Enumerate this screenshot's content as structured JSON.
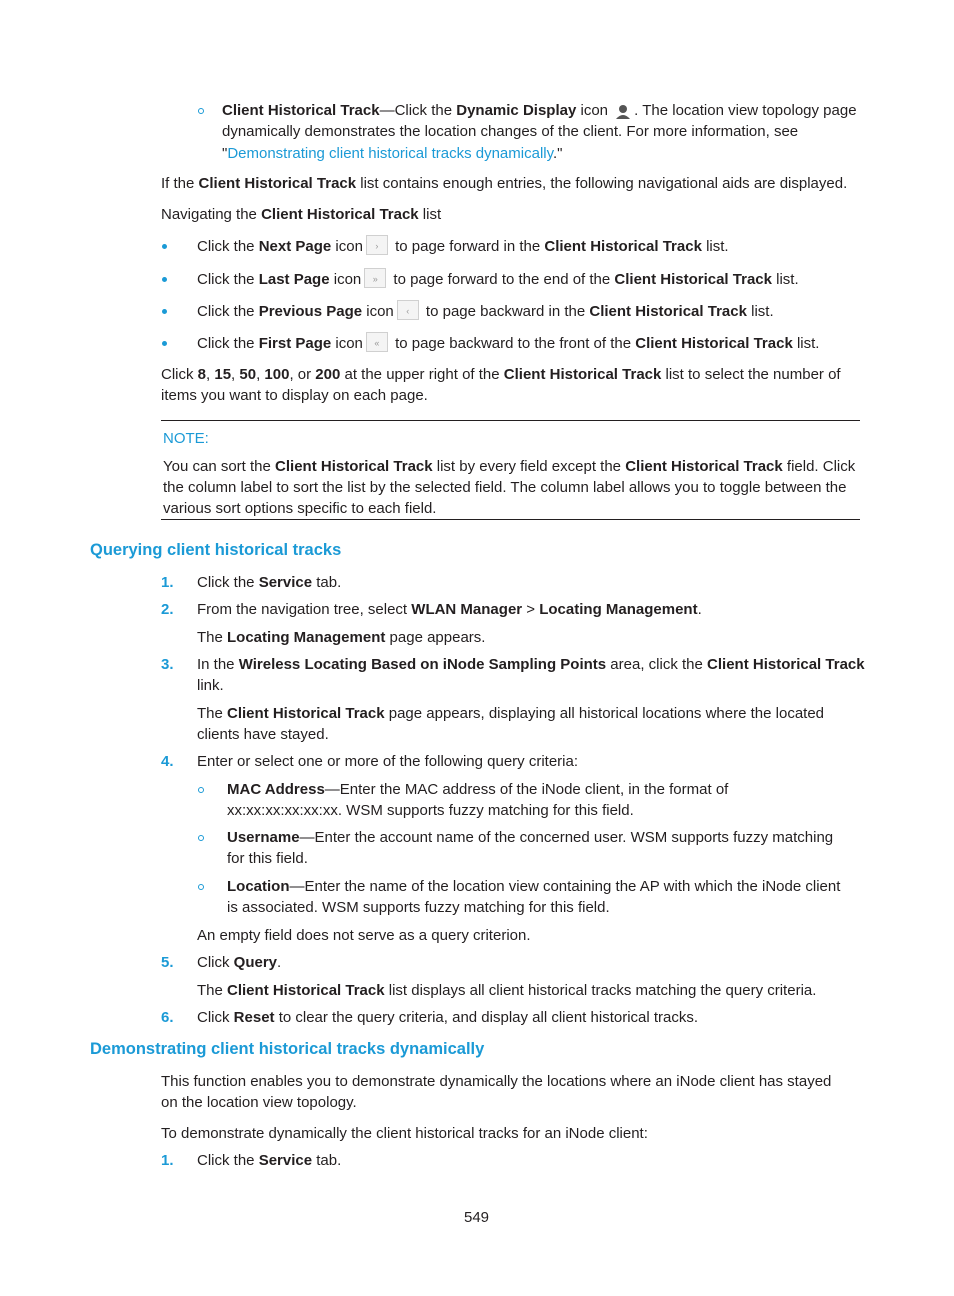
{
  "top_item": {
    "label": "Client Historical Track",
    "dash_text": "—Click the ",
    "dynamic_display": "Dynamic Display",
    "icon_text": " icon ",
    "icon": "person-icon",
    "after_icon": ". The location view topology page",
    "line2": "dynamically demonstrates the location changes of the client. For more information, see",
    "quote_open": "\"",
    "link_text": "Demonstrating client historical tracks dynamically",
    "quote_close": ".\""
  },
  "para_enough": {
    "pre": "If the ",
    "bold": "Client Historical Track",
    "post": " list contains enough entries, the following navigational aids are displayed."
  },
  "nav_label": {
    "pre": "Navigating the ",
    "bold": "Client Historical Track",
    "post": " list"
  },
  "nav_items": [
    {
      "pre": "Click the ",
      "bold": "Next Page",
      "mid": " icon",
      "icon": "›",
      "icon_name": "next-page-icon",
      "post": " to page forward in the ",
      "bold2": "Client Historical Track",
      "end": " list."
    },
    {
      "pre": "Click the ",
      "bold": "Last Page",
      "mid": " icon",
      "icon": "»",
      "icon_name": "last-page-icon",
      "post": " to page forward to the end of the ",
      "bold2": "Client Historical Track",
      "end": " list."
    },
    {
      "pre": "Click the ",
      "bold": "Previous Page",
      "mid": " icon",
      "icon": "‹",
      "icon_name": "previous-page-icon",
      "post": " to page backward in the ",
      "bold2": "Client Historical Track",
      "end": " list."
    },
    {
      "pre": "Click the ",
      "bold": "First Page",
      "mid": " icon",
      "icon": "«",
      "icon_name": "first-page-icon",
      "post": " to page backward to the front of the ",
      "bold2": "Client Historical Track",
      "end": " list."
    }
  ],
  "page_size": {
    "pre": "Click ",
    "n1": "8",
    "c1": ", ",
    "n2": "15",
    "c2": ", ",
    "n3": "50",
    "c3": ", ",
    "n4": "100",
    "c4": ", or ",
    "n5": "200",
    "mid": " at the upper right of the ",
    "bold": "Client Historical Track",
    "post": " list to select the number of",
    "line2": "items you want to display on each page."
  },
  "note": {
    "title": "NOTE:",
    "l1_pre": "You can sort the ",
    "l1_b1": "Client Historical Track",
    "l1_mid": " list by every field except the ",
    "l1_b2": "Client Historical Track",
    "l1_post": " field. Click",
    "line2": "the column label to sort the list by the selected field. The column label allows you to toggle between the",
    "line3": "various sort options specific to each field."
  },
  "section1": {
    "heading": "Querying client historical tracks",
    "steps": [
      {
        "num": "1.",
        "pre": "Click the ",
        "bold": "Service",
        "post": " tab."
      },
      {
        "num": "2.",
        "pre": "From the navigation tree, select ",
        "bold": "WLAN Manager",
        "mid": " > ",
        "bold2": "Locating Management",
        "post": "."
      },
      {
        "num": "3.",
        "pre": "In the ",
        "bold": "Wireless Locating Based on iNode Sampling Points",
        "mid": " area, click the ",
        "bold2": "Client Historical Track",
        "line2": "link."
      },
      {
        "num": "4.",
        "text": "Enter or select one or more of the following query criteria:"
      },
      {
        "num": "5.",
        "pre": "Click ",
        "bold": "Query",
        "post": "."
      },
      {
        "num": "6.",
        "pre": "Click ",
        "bold": "Reset",
        "post": " to clear the query criteria, and display all client historical tracks."
      }
    ],
    "step2_result": {
      "pre": "The ",
      "bold": "Locating Management",
      "post": " page appears."
    },
    "step3_result": {
      "pre": "The ",
      "bold": "Client Historical Track",
      "post": " page appears, displaying all historical locations where the located",
      "line2": "clients have stayed."
    },
    "criteria": [
      {
        "bold": "MAC Address",
        "text": "—Enter the MAC address of the iNode client, in the format of",
        "line2": "xx:xx:xx:xx:xx:xx. WSM supports fuzzy matching for this field."
      },
      {
        "bold": "Username",
        "text": "—Enter the account name of the concerned user. WSM supports fuzzy matching",
        "line2": "for this field."
      },
      {
        "bold": "Location",
        "text": "—Enter the name of the location view containing the AP with which the iNode client",
        "line2": "is associated. WSM supports fuzzy matching for this field."
      }
    ],
    "empty_note": "An empty field does not serve as a query criterion.",
    "step5_result": {
      "pre": "The ",
      "bold": "Client Historical Track",
      "post": " list displays all client historical tracks matching the query criteria."
    }
  },
  "section2": {
    "heading": "Demonstrating client historical tracks dynamically",
    "para1_l1": "This function enables you to demonstrate dynamically the locations where an iNode client has stayed",
    "para1_l2": "on the location view topology.",
    "para2": "To demonstrate dynamically the client historical tracks for an iNode client:",
    "step1": {
      "num": "1.",
      "pre": "Click the ",
      "bold": "Service",
      "post": " tab."
    }
  },
  "page_number": "549"
}
